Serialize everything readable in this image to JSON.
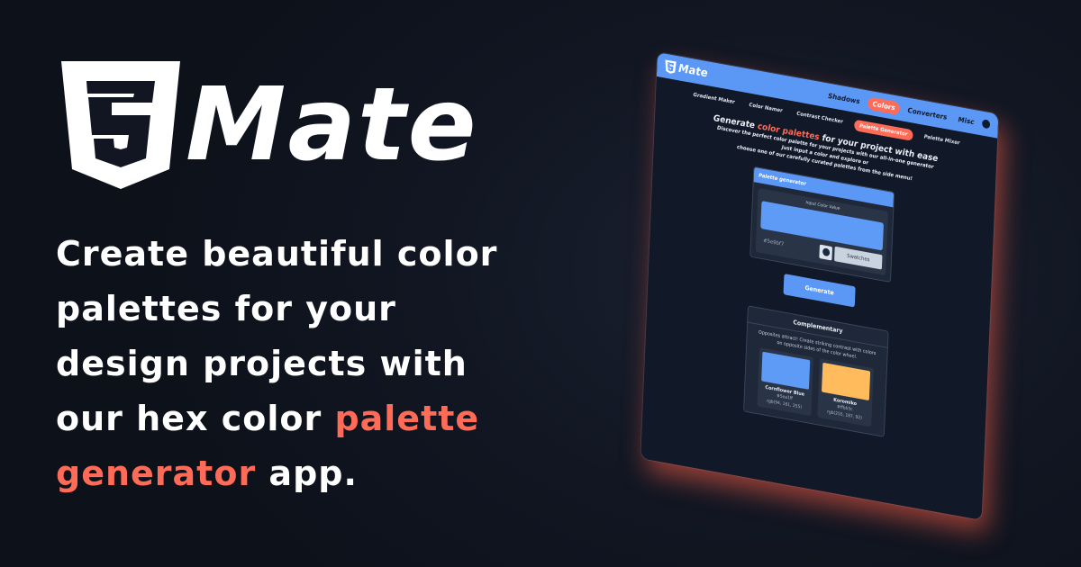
{
  "brand": {
    "name": "Mate",
    "logo_icon": "css3-shield-icon"
  },
  "tagline": {
    "part1": "Create beautiful color palettes for your design projects with our hex color ",
    "accent1": "palette",
    "space": " ",
    "accent2": "generator",
    "part2": " app."
  },
  "colors": {
    "accent": "#ff6b57",
    "primary": "#5b98f5",
    "background": "#111622"
  },
  "mockup": {
    "brand": "Mate",
    "nav": [
      "Shadows",
      "Colors",
      "Converters",
      "Misc"
    ],
    "nav_active": "Colors",
    "subnav": [
      "Gradient Maker",
      "Color Namer",
      "Contrast Checker",
      "Palette Generator",
      "Palette Mixer"
    ],
    "subnav_active": "Palette Generator",
    "hero": {
      "title_pre": "Generate ",
      "title_accent": "color palettes",
      "title_post": " for your project with ease",
      "line1": "Discover the perfect color palette for your projects with our all-in-one generator",
      "line2": "Just input a color and explore or",
      "line3": "choose one of our carefully curated palettes from the side menu!"
    },
    "generator": {
      "title": "Palette generator",
      "input_label": "Input Color Value",
      "hex_value": "#5e9bf7",
      "swatches_label": "Swatches",
      "generate_label": "Generate"
    },
    "complementary": {
      "title": "Complementary",
      "description": "Opposites attract! Create striking contrast with colors on opposite sides of the color wheel.",
      "swatches": [
        {
          "name": "Cornflower Blue",
          "hex": "#5ea1ff",
          "rgb": "rgb(94, 161, 255)",
          "color": "#5e9bf7"
        },
        {
          "name": "Koromiko",
          "hex": "#ffbb5c",
          "rgb": "rgb(255, 187, 92)",
          "color": "#ffbb5c"
        }
      ]
    }
  }
}
